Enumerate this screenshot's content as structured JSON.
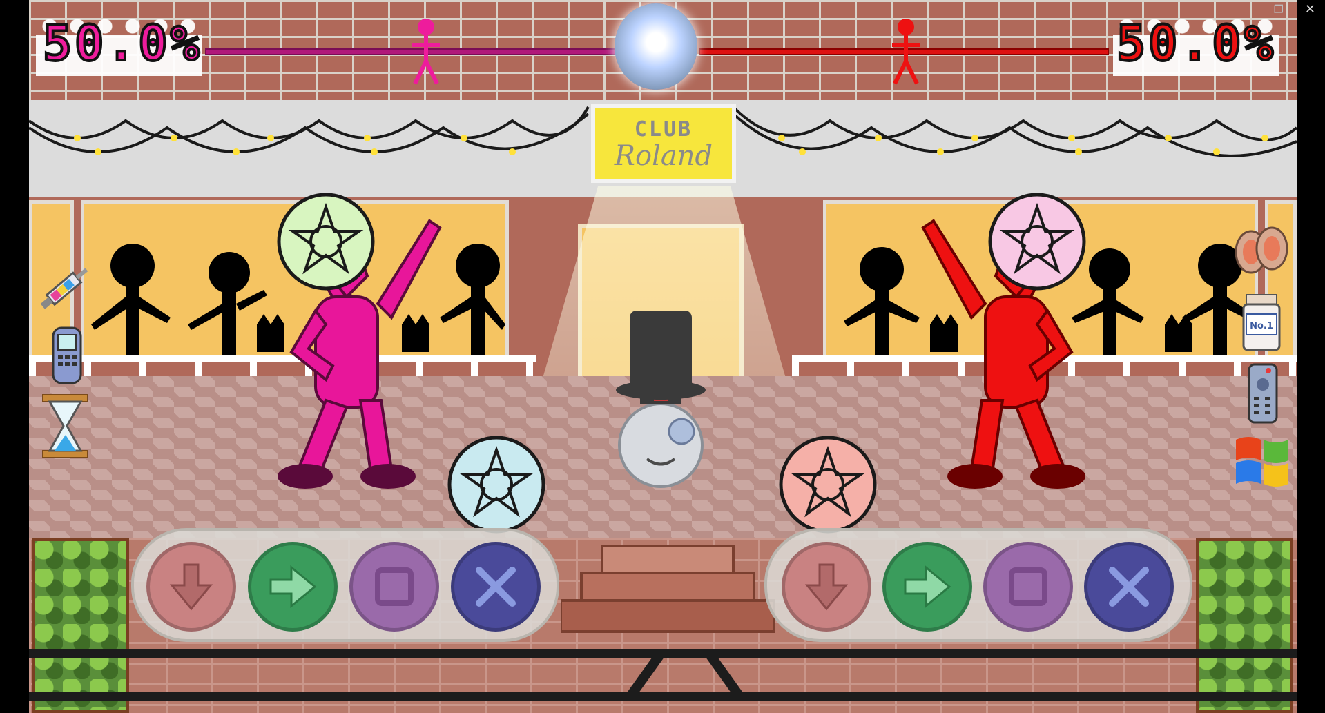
{
  "window": {
    "restore_glyph": "❐",
    "close_glyph": "✕"
  },
  "hud": {
    "left_percent": "50.0%",
    "right_percent": "50.0%",
    "left_color": "#ee1c9c",
    "right_color": "#ee1111",
    "left_progress": 0.5,
    "right_progress": 0.5
  },
  "sign": {
    "line1": "CLUB",
    "line2": "Roland"
  },
  "colors": {
    "down": "#c98282",
    "right": "#3a9c5c",
    "square": "#9a6aaa",
    "cross": "#4a4a9a"
  },
  "left_buttons": [
    {
      "name": "down-arrow-button",
      "icon": "down-arrow-icon"
    },
    {
      "name": "right-arrow-button",
      "icon": "right-arrow-icon"
    },
    {
      "name": "square-button",
      "icon": "square-icon"
    },
    {
      "name": "cross-button",
      "icon": "cross-icon"
    }
  ],
  "right_buttons": [
    {
      "name": "down-arrow-button",
      "icon": "down-arrow-icon"
    },
    {
      "name": "right-arrow-button",
      "icon": "right-arrow-icon"
    },
    {
      "name": "square-button",
      "icon": "square-icon"
    },
    {
      "name": "cross-button",
      "icon": "cross-icon"
    }
  ],
  "left_items": [
    "syringe-icon",
    "mobile-phone-icon",
    "hourglass-icon"
  ],
  "right_items": [
    "target-icon",
    "pill-jar-icon",
    "remote-control-icon",
    "windows-logo-icon"
  ],
  "jar_label": "No.1"
}
